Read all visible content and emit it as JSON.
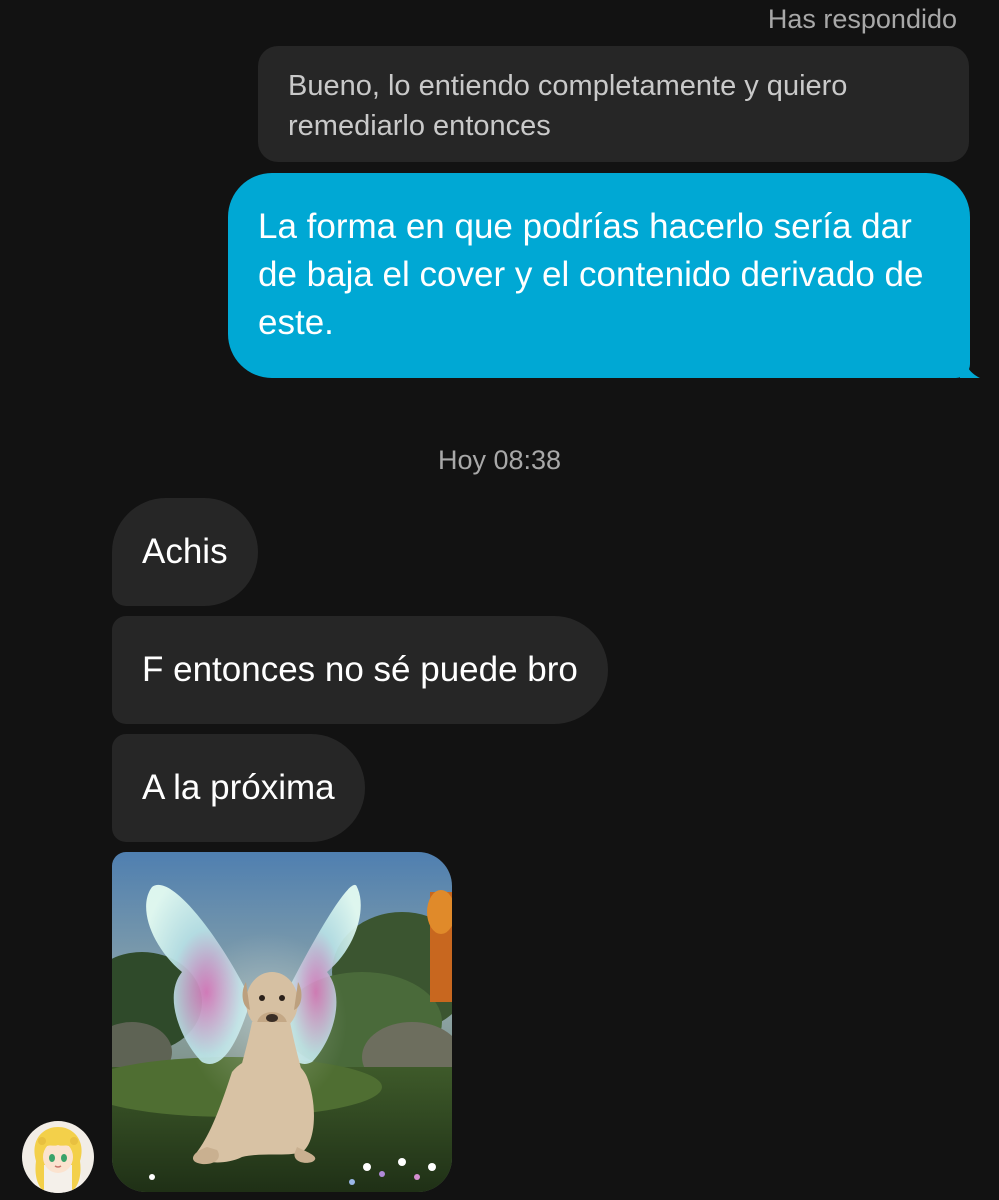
{
  "thread": {
    "reply_label": "Has respondido",
    "quoted_message": "Bueno, lo entiendo completamente y quiero remediarlo entonces",
    "sent_message": "La forma en que podrías hacerlo sería dar de baja el cover y el contenido derivado de este.",
    "timestamp": "Hoy 08:38",
    "received_messages": [
      "Achis",
      "F entonces no sé puede bro",
      "A la próxima"
    ]
  },
  "colors": {
    "background": "#121212",
    "sent_bubble": "#00a8d4",
    "received_bubble": "#262626",
    "secondary_text": "#a8a8a8"
  },
  "icons": {
    "avatar": "anime-character-avatar",
    "photo": "dog-with-fairy-wings-image"
  }
}
